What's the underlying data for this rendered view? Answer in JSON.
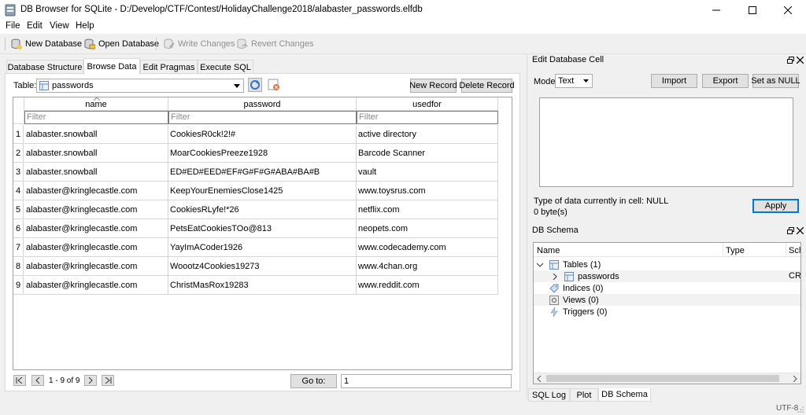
{
  "window": {
    "title": "DB Browser for SQLite - D:/Develop/CTF/Contest/HolidayChallenge2018/alabaster_passwords.elfdb"
  },
  "menu": [
    "File",
    "Edit",
    "View",
    "Help"
  ],
  "toolbar": {
    "new_db": "New Database",
    "open_db": "Open Database",
    "write": "Write Changes",
    "revert": "Revert Changes"
  },
  "tabs": [
    "Database Structure",
    "Browse Data",
    "Edit Pragmas",
    "Execute SQL"
  ],
  "browse": {
    "table_label": "Table:",
    "table_value": "passwords",
    "new_record": "New Record",
    "delete_record": "Delete Record",
    "columns": [
      "name",
      "password",
      "usedfor"
    ],
    "filter_placeholder": "Filter",
    "rows": [
      {
        "n": "1",
        "name": "alabaster.snowball",
        "password": "CookiesR0ck!2!#",
        "usedfor": "active directory"
      },
      {
        "n": "2",
        "name": "alabaster.snowball",
        "password": "MoarCookiesPreeze1928",
        "usedfor": "Barcode Scanner"
      },
      {
        "n": "3",
        "name": "alabaster.snowball",
        "password": "ED#ED#EED#EF#G#F#G#ABA#BA#B",
        "usedfor": "vault"
      },
      {
        "n": "4",
        "name": "alabaster@kringlecastle.com",
        "password": "KeepYourEnemiesClose1425",
        "usedfor": "www.toysrus.com"
      },
      {
        "n": "5",
        "name": "alabaster@kringlecastle.com",
        "password": "CookiesRLyfe!*26",
        "usedfor": "netflix.com"
      },
      {
        "n": "6",
        "name": "alabaster@kringlecastle.com",
        "password": "PetsEatCookiesTOo@813",
        "usedfor": "neopets.com"
      },
      {
        "n": "7",
        "name": "alabaster@kringlecastle.com",
        "password": "YayImACoder1926",
        "usedfor": "www.codecademy.com"
      },
      {
        "n": "8",
        "name": "alabaster@kringlecastle.com",
        "password": "Woootz4Cookies19273",
        "usedfor": "www.4chan.org"
      },
      {
        "n": "9",
        "name": "alabaster@kringlecastle.com",
        "password": "ChristMasRox19283",
        "usedfor": "www.reddit.com"
      }
    ],
    "pager_text": "1 - 9 of 9",
    "goto_label": "Go to:",
    "goto_value": "1"
  },
  "edit_cell": {
    "title": "Edit Database Cell",
    "mode_label": "Mode:",
    "mode_value": "Text",
    "import": "Import",
    "export": "Export",
    "set_null": "Set as NULL",
    "type_info": "Type of data currently in cell: NULL",
    "size_info": "0 byte(s)",
    "apply": "Apply"
  },
  "schema": {
    "title": "DB Schema",
    "col_name": "Name",
    "col_type": "Type",
    "col_schema": "Sch",
    "tables": "Tables (1)",
    "table_item": "passwords",
    "table_item_schema": "CRE",
    "indices": "Indices (0)",
    "views": "Views (0)",
    "triggers": "Triggers (0)"
  },
  "bottom_tabs": [
    "SQL Log",
    "Plot",
    "DB Schema"
  ],
  "status": {
    "encoding": "UTF-8"
  }
}
